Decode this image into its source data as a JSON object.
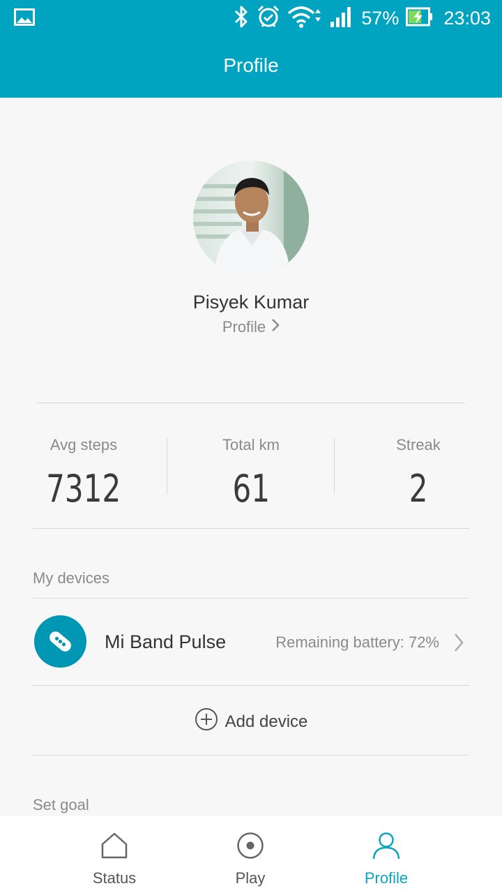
{
  "status_bar": {
    "battery_percent": "57%",
    "time": "23:03",
    "icons": [
      "gallery-icon",
      "bluetooth-icon",
      "alarm-icon",
      "wifi-icon",
      "signal-icon",
      "battery-charging-icon"
    ]
  },
  "header": {
    "title": "Profile"
  },
  "user": {
    "name": "Pisyek Kumar",
    "profile_link": "Profile"
  },
  "stats": [
    {
      "label": "Avg steps",
      "value": "7312"
    },
    {
      "label": "Total km",
      "value": "61"
    },
    {
      "label": "Streak",
      "value": "2"
    }
  ],
  "devices": {
    "section_title": "My devices",
    "items": [
      {
        "name": "Mi Band Pulse",
        "battery": "Remaining battery: 72%"
      }
    ],
    "add_label": "Add device"
  },
  "goal": {
    "section_title": "Set goal"
  },
  "bottom_nav": [
    {
      "label": "Status",
      "icon": "home-icon",
      "active": false
    },
    {
      "label": "Play",
      "icon": "play-circle-icon",
      "active": false
    },
    {
      "label": "Profile",
      "icon": "person-icon",
      "active": true
    }
  ],
  "colors": {
    "accent": "#00a4c0",
    "background": "#f7f7f7",
    "nav_active": "#0aa4c0"
  }
}
